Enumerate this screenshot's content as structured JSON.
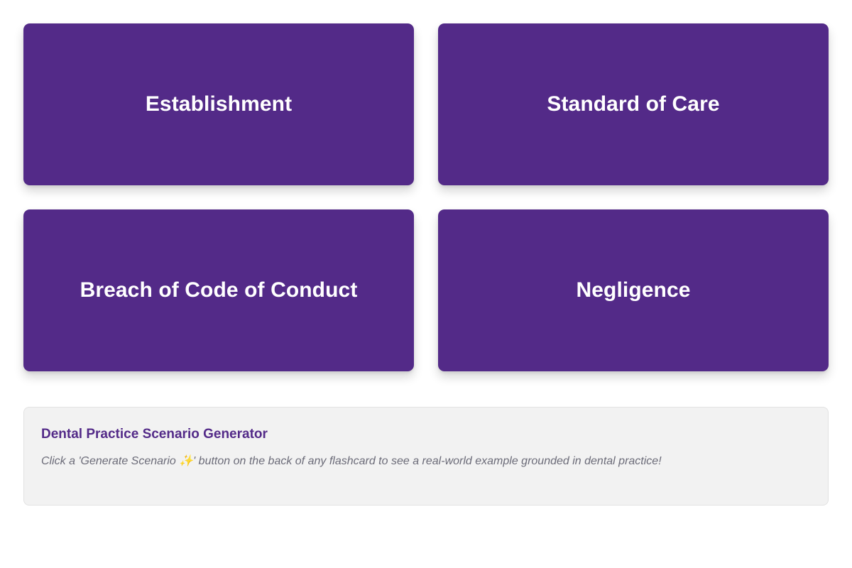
{
  "flashcards": [
    {
      "title": "Establishment"
    },
    {
      "title": "Standard of Care"
    },
    {
      "title": "Breach of Code of Conduct"
    },
    {
      "title": "Negligence"
    }
  ],
  "scenario_panel": {
    "title": "Dental Practice Scenario Generator",
    "text": "Click a 'Generate Scenario ✨' button on the back of any flashcard to see a real-world example grounded in dental practice!"
  },
  "colors": {
    "card_background": "#532a88",
    "card_text": "#ffffff",
    "panel_background": "#f2f2f2",
    "panel_title": "#532a88",
    "panel_text": "#6b6b78"
  }
}
